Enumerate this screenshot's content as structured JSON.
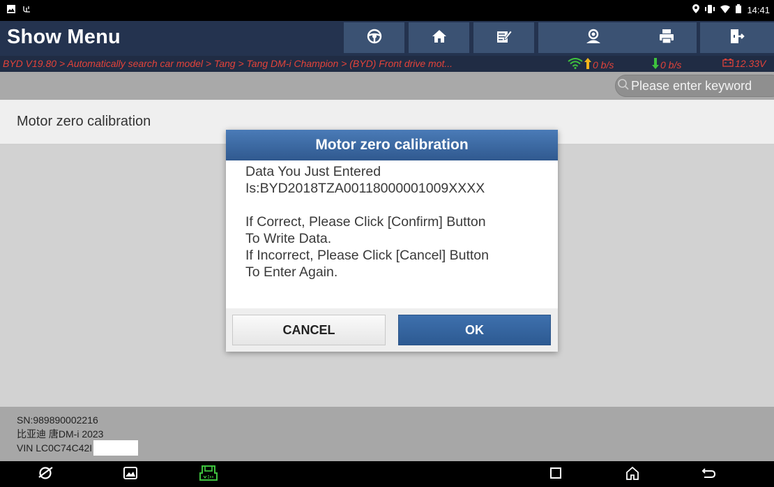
{
  "status_bar": {
    "time": "14:41"
  },
  "header": {
    "title": "Show Menu",
    "toolbar": [
      {
        "name": "steering-wheel-icon"
      },
      {
        "name": "home-icon"
      },
      {
        "name": "edit-icon"
      },
      {
        "name": "feedback-icon"
      },
      {
        "name": "print-icon"
      },
      {
        "name": "exit-icon"
      }
    ]
  },
  "breadcrumb": {
    "path": "BYD V19.80 > Automatically search car model > Tang > Tang DM-i Champion > (BYD) Front drive mot...",
    "upload_speed": "0 b/s",
    "download_speed": "0 b/s",
    "voltage": "12.33V"
  },
  "search": {
    "placeholder": "Please enter keyword"
  },
  "list": {
    "item_label": "Motor zero calibration"
  },
  "footer": {
    "sn": "SN:989890002216",
    "vehicle": "比亚迪 唐DM-i 2023",
    "vin": "VIN LC0C74C42I"
  },
  "dialog": {
    "title": "Motor zero calibration",
    "line1": "Data You Just Entered",
    "line2": "Is:BYD2018TZA00118000001009XXXX",
    "line3": "If Correct, Please Click [Confirm] Button",
    "line4": "To Write Data.",
    "line5": "If Incorrect, Please Click [Cancel] Button",
    "line6": "To Enter Again.",
    "cancel_label": "CANCEL",
    "ok_label": "OK"
  },
  "colors": {
    "header_bg": "#24334f",
    "toolbar_btn": "#3b5273",
    "breadcrumb_text": "#e3433a",
    "dialog_title": "#3b6aa4",
    "ok_button": "#2f5c93",
    "vci_icon": "#3ec23e"
  }
}
